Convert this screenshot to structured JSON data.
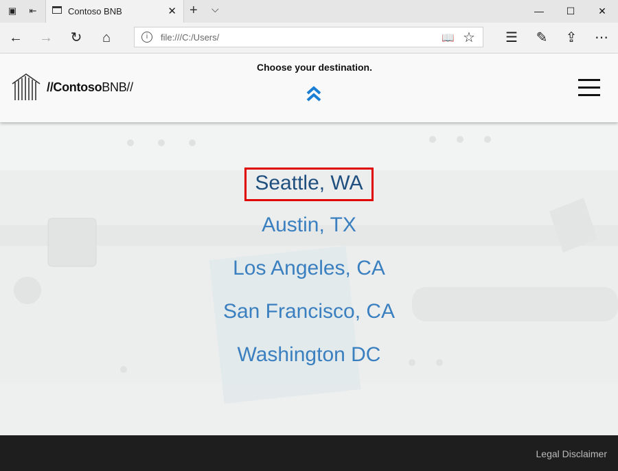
{
  "browser": {
    "tab_title": "Contoso BNB",
    "address": "file:///C:/Users/",
    "window_controls": [
      "minimize-icon",
      "maximize-icon",
      "close-icon"
    ]
  },
  "header": {
    "prompt": "Choose your destination.",
    "logo_text_prefix": "//Contoso",
    "logo_text_suffix": "BNB//"
  },
  "destinations": [
    {
      "label": "Seattle, WA",
      "selected": true
    },
    {
      "label": "Austin, TX",
      "selected": false
    },
    {
      "label": "Los Angeles, CA",
      "selected": false
    },
    {
      "label": "San Francisco, CA",
      "selected": false
    },
    {
      "label": "Washington DC",
      "selected": false
    }
  ],
  "footer": {
    "legal_link": "Legal Disclaimer"
  },
  "colors": {
    "link": "#3a7fbf",
    "selected_link": "#1f4f7f",
    "selection_border": "#e00000",
    "chevron_accent": "#1a7fd4",
    "footer_bg": "#1e1e1e"
  }
}
